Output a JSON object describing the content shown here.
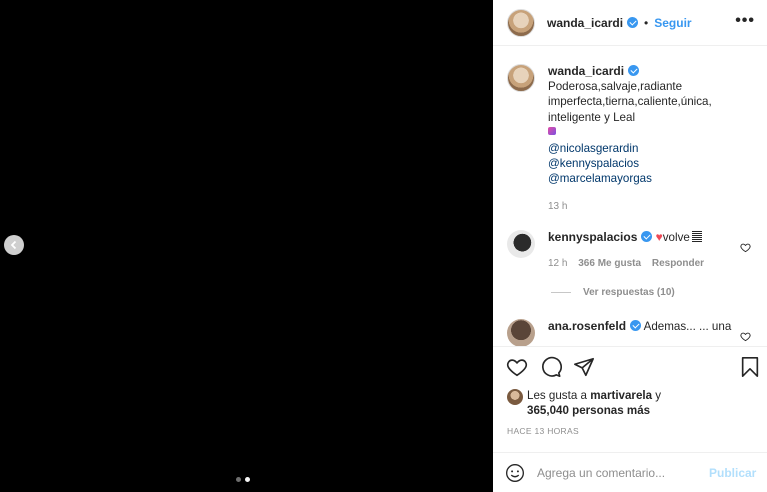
{
  "post": {
    "username": "wanda_icardi",
    "follow_label": "Seguir",
    "dot_separator": "•",
    "more_label": "•••"
  },
  "caption": {
    "username": "wanda_icardi",
    "line1": "Poderosa,salvaje,radiante",
    "line2": "imperfecta,tierna,caliente,única,",
    "line3": "inteligente y Leal",
    "mentions": [
      "@nicolasgerardin",
      "@kennyspalacios",
      "@marcelamayorgas"
    ],
    "time": "13 h"
  },
  "comments": [
    {
      "username": "kennyspalacios",
      "heart": "♥",
      "text": "volve",
      "time": "12 h",
      "likes": "366 Me gusta",
      "reply_label": "Responder"
    },
    {
      "username": "ana.rosenfeld",
      "text": "Ademas... ... una"
    }
  ],
  "replies_label": "Ver respuestas (10)",
  "likes": {
    "prefix": "Les gusta a",
    "user": "martivarela",
    "conj": "y",
    "count": "365,040 personas más"
  },
  "ago": "HACE 13 HORAS",
  "add_comment": {
    "placeholder": "Agrega un comentario...",
    "publish_label": "Publicar"
  },
  "colors": {
    "accent": "#3897f0",
    "mention": "#00376b",
    "publish_disabled": "#b2dffc"
  },
  "carousel": {
    "total": 2,
    "current": 2
  }
}
